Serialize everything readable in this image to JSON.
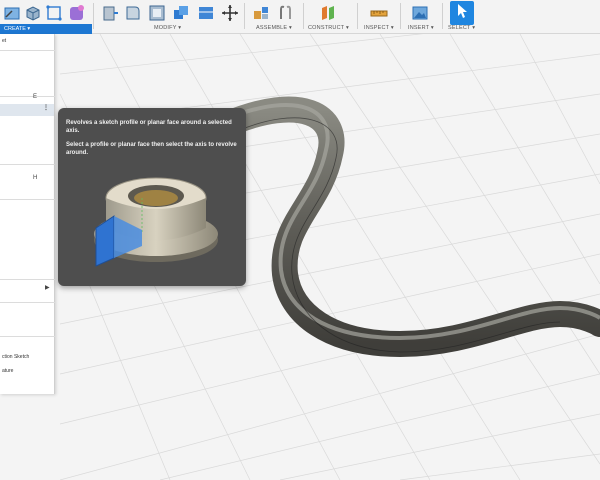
{
  "toolbar": {
    "create_label": "CREATE ▾",
    "groups": [
      {
        "label": "MODIFY ▾"
      },
      {
        "label": "ASSEMBLE ▾"
      },
      {
        "label": "CONSTRUCT ▾"
      },
      {
        "label": "INSPECT ▾"
      },
      {
        "label": "INSERT ▾"
      },
      {
        "label": "SELECT ▾"
      }
    ],
    "icons": [
      "create-sketch-icon",
      "extrude-icon",
      "revolve-icon",
      "sweep-icon",
      "form-icon",
      "press-pull-icon",
      "fillet-icon",
      "shell-icon",
      "combine-icon",
      "replace-face-icon",
      "move-icon",
      "new-component-icon",
      "joint-icon",
      "offset-plane-icon",
      "measure-icon",
      "insert-image-icon",
      "select-cursor-icon"
    ],
    "accent": "#1d77d2"
  },
  "menu": {
    "items": [
      {
        "label": "et"
      },
      {
        "label": "ction Sketch"
      },
      {
        "label": "ature"
      }
    ],
    "shortcut_e": "E",
    "shortcut_h": "H"
  },
  "tooltip": {
    "title": "Revolves a sketch profile or planar face around a selected axis.",
    "body": "Select a profile or planar face then select the axis to revolve around."
  }
}
